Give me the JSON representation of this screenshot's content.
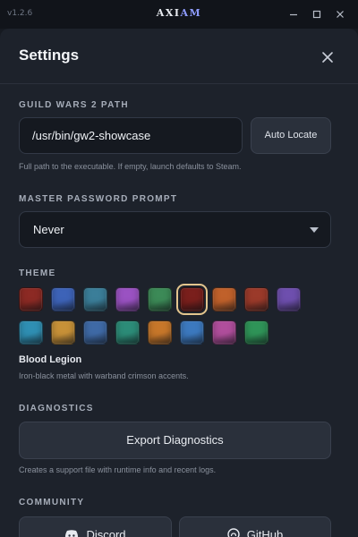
{
  "titlebar": {
    "version": "v1.2.6",
    "logo_part1": "AXI",
    "logo_part2": "AM",
    "logo_accent_color": "#8f9cff"
  },
  "settings": {
    "title": "Settings",
    "gw2_path": {
      "label": "GUILD WARS 2 PATH",
      "value": "/usr/bin/gw2-showcase",
      "auto_locate_label": "Auto Locate",
      "hint": "Full path to the executable. If empty, launch defaults to Steam."
    },
    "master_password": {
      "label": "MASTER PASSWORD PROMPT",
      "selected": "Never"
    },
    "theme": {
      "label": "THEME",
      "swatches": [
        {
          "color": "#8c2a24",
          "selected": false
        },
        {
          "color": "#3d63b8",
          "selected": false
        },
        {
          "color": "#3b7e99",
          "selected": false
        },
        {
          "color": "#9a52c2",
          "selected": false
        },
        {
          "color": "#3c8a57",
          "selected": false
        },
        {
          "color": "#7a1f1c",
          "selected": true
        },
        {
          "color": "#c0612b",
          "selected": false
        },
        {
          "color": "#9b3a2a",
          "selected": false
        },
        {
          "color": "#6e4fae",
          "selected": false
        },
        {
          "color": "#2f8fb3",
          "selected": false
        },
        {
          "color": "#c79138",
          "selected": false
        },
        {
          "color": "#3f6aa6",
          "selected": false
        },
        {
          "color": "#2c8c78",
          "selected": false
        },
        {
          "color": "#c7772a",
          "selected": false
        },
        {
          "color": "#3c79bf",
          "selected": false
        },
        {
          "color": "#b04e9c",
          "selected": false
        },
        {
          "color": "#2f9458",
          "selected": false
        }
      ],
      "selected_name": "Blood Legion",
      "selected_description": "Iron-black metal with warband crimson accents."
    },
    "diagnostics": {
      "label": "DIAGNOSTICS",
      "button": "Export Diagnostics",
      "hint": "Creates a support file with runtime info and recent logs."
    },
    "community": {
      "label": "COMMUNITY",
      "discord": "Discord",
      "github": "GitHub"
    }
  }
}
